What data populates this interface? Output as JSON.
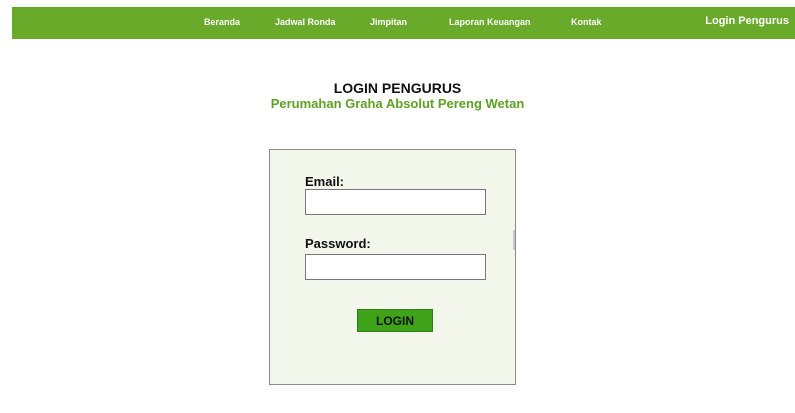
{
  "navbar": {
    "items": [
      {
        "label": "Beranda"
      },
      {
        "label": "Jadwal Ronda"
      },
      {
        "label": "Jimpitan"
      },
      {
        "label": "Laporan Keuangan"
      },
      {
        "label": "Kontak"
      }
    ],
    "login_label": "Login Pengurus"
  },
  "header": {
    "title": "LOGIN PENGURUS",
    "subtitle": "Perumahan Graha Absolut Pereng Wetan"
  },
  "form": {
    "email_label": "Email:",
    "email_value": "",
    "password_label": "Password:",
    "password_value": "",
    "button_label": "LOGIN"
  },
  "colors": {
    "brand": "#6aaa2a",
    "button": "#3fa31a",
    "subtitle": "#5fa123",
    "panel": "#f3f6ea"
  }
}
